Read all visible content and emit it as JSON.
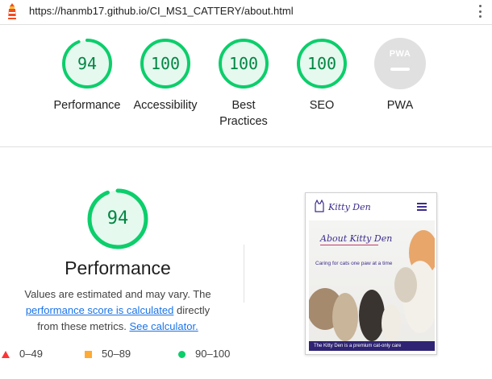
{
  "url": "https://hanmb17.github.io/CI_MS1_CATTERY/about.html",
  "categories": [
    {
      "label": "Performance",
      "score": "94",
      "fraction": 0.94
    },
    {
      "label": "Accessibility",
      "score": "100",
      "fraction": 1.0
    },
    {
      "label": "Best\nPractices",
      "score": "100",
      "fraction": 1.0
    },
    {
      "label": "SEO",
      "score": "100",
      "fraction": 1.0
    },
    {
      "label": "PWA",
      "badge": "PWA"
    }
  ],
  "performance": {
    "score": "94",
    "fraction": 0.94,
    "title": "Performance",
    "desc_1": "Values are estimated and may vary. The",
    "desc_link": "performance score is calculated",
    "desc_2": "directly",
    "desc_3": "from these metrics.",
    "calc_link": "See calculator."
  },
  "legend": [
    {
      "shape": "triangle",
      "range": "0–49",
      "color": "#ff3333"
    },
    {
      "shape": "square",
      "range": "50–89",
      "color": "#ffaa33"
    },
    {
      "shape": "circle",
      "range": "90–100",
      "color": "#0cce6b"
    }
  ],
  "screenshot": {
    "brand": "Kitty Den",
    "hero_title": "About Kitty Den",
    "tagline": "Caring for cats one paw at a time",
    "footer": "The Kitty Den is a premium cat-only care"
  },
  "colors": {
    "pass": "#0cce6b",
    "pass_text": "#018642",
    "pass_fill": "#e5f9ef",
    "link": "#1a73e8",
    "pwa_grey": "#e0e0e0"
  }
}
